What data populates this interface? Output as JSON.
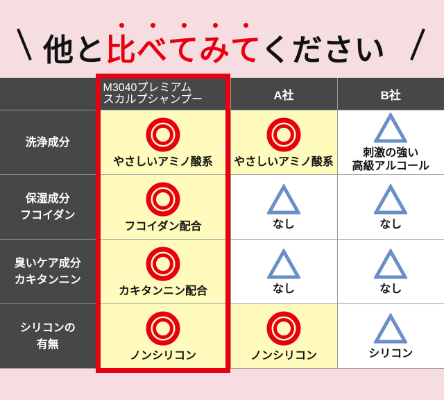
{
  "title": {
    "prefix": "他と",
    "accent_chars": [
      "比",
      "べ",
      "て",
      "み",
      "て"
    ],
    "suffix": "ください"
  },
  "colors": {
    "accent_red": "#e60012",
    "triangle_blue": "#6a8fc8",
    "header_bg": "#474747",
    "highlight_yellow": "#fffbbd",
    "page_bg": "#f5dde1"
  },
  "table": {
    "columns": [
      {
        "label": ""
      },
      {
        "label_line1": "M3040プレミアム",
        "label_line2": "スカルプシャンプー",
        "highlighted": true
      },
      {
        "label": "A社"
      },
      {
        "label": "B社"
      }
    ],
    "rows": [
      {
        "label_line1": "洗浄成分",
        "label_line2": "",
        "cells": [
          {
            "mark": "double-circle",
            "text_line1": "やさしいアミノ酸系",
            "text_line2": "",
            "bg": "yellow"
          },
          {
            "mark": "double-circle",
            "text_line1": "やさしいアミノ酸系",
            "text_line2": "",
            "bg": "yellow"
          },
          {
            "mark": "triangle",
            "text_line1": "刺激の強い",
            "text_line2": "高級アルコール",
            "bg": "white"
          }
        ]
      },
      {
        "label_line1": "保湿成分",
        "label_line2": "フコイダン",
        "cells": [
          {
            "mark": "double-circle",
            "text_line1": "フコイダン配合",
            "text_line2": "",
            "bg": "yellow"
          },
          {
            "mark": "triangle",
            "text_line1": "なし",
            "text_line2": "",
            "bg": "white"
          },
          {
            "mark": "triangle",
            "text_line1": "なし",
            "text_line2": "",
            "bg": "white"
          }
        ]
      },
      {
        "label_line1": "臭いケア成分",
        "label_line2": "カキタンニン",
        "cells": [
          {
            "mark": "double-circle",
            "text_line1": "カキタンニン配合",
            "text_line2": "",
            "bg": "yellow"
          },
          {
            "mark": "triangle",
            "text_line1": "なし",
            "text_line2": "",
            "bg": "white"
          },
          {
            "mark": "triangle",
            "text_line1": "なし",
            "text_line2": "",
            "bg": "white"
          }
        ]
      },
      {
        "label_line1": "シリコンの",
        "label_line2": "有無",
        "cells": [
          {
            "mark": "double-circle",
            "text_line1": "ノンシリコン",
            "text_line2": "",
            "bg": "yellow"
          },
          {
            "mark": "double-circle",
            "text_line1": "ノンシリコン",
            "text_line2": "",
            "bg": "yellow"
          },
          {
            "mark": "triangle",
            "text_line1": "シリコン",
            "text_line2": "",
            "bg": "white"
          }
        ]
      }
    ]
  }
}
